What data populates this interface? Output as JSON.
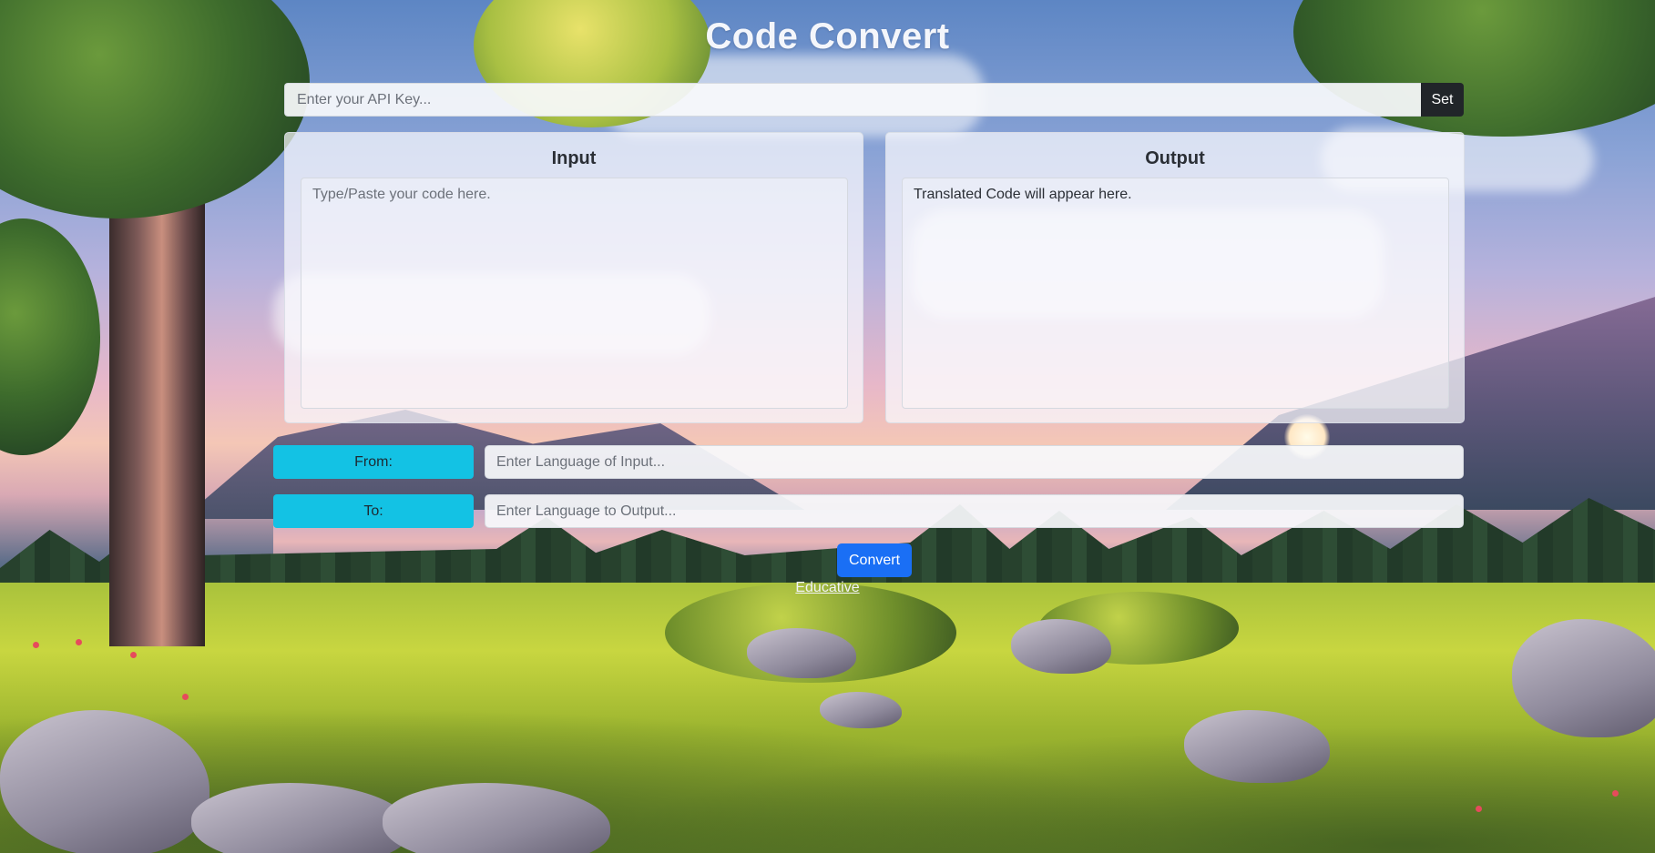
{
  "header": {
    "title": "Code Convert"
  },
  "api_key": {
    "placeholder": "Enter your API Key...",
    "value": "",
    "set_label": "Set"
  },
  "input_panel": {
    "title": "Input",
    "placeholder": "Type/Paste your code here."
  },
  "output_panel": {
    "title": "Output",
    "text": "Translated Code will appear here."
  },
  "from": {
    "label": "From:",
    "placeholder": "Enter Language of Input..."
  },
  "to": {
    "label": "To:",
    "placeholder": "Enter Language to Output..."
  },
  "actions": {
    "convert_label": "Convert"
  },
  "footer": {
    "link_text": "Educative"
  },
  "colors": {
    "label_accent": "#13c2e4",
    "primary_button": "#1a6ff5",
    "dark_button": "#212529"
  }
}
